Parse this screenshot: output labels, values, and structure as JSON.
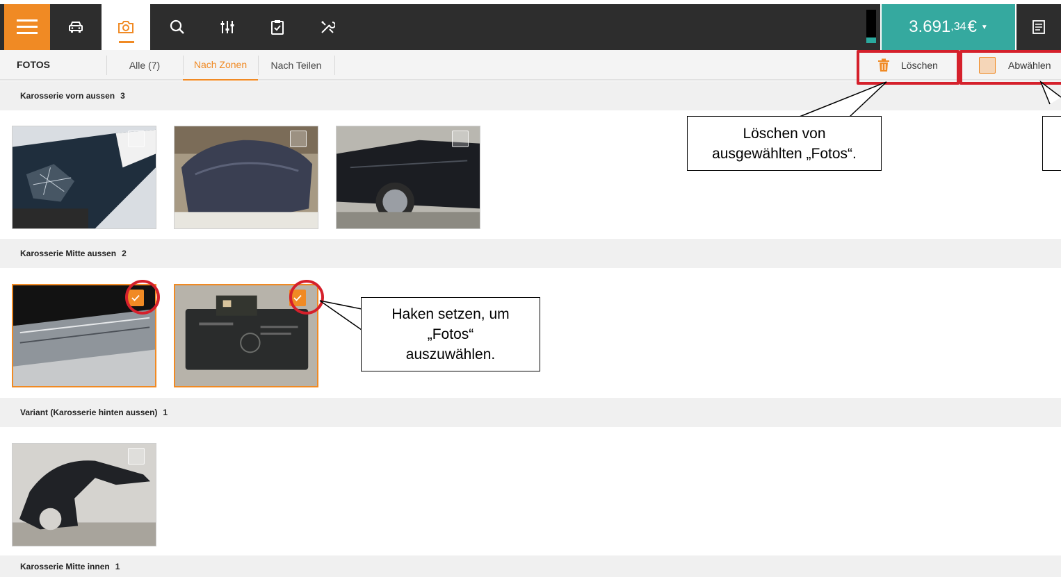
{
  "topbar": {
    "menu_icon": "hamburger-icon",
    "nav_icons": [
      "car-icon",
      "camera-icon",
      "search-icon",
      "sliders-icon",
      "checklist-icon",
      "tools-icon"
    ],
    "price_main": "3.691",
    "price_cents": ",34",
    "price_currency": "€",
    "receipt_icon": "receipt-icon",
    "brand_color": "#f08a24",
    "teal_color": "#35a99f"
  },
  "tabs": {
    "title": "FOTOS",
    "items": [
      {
        "label": "Alle (7)"
      },
      {
        "label": "Nach Zonen"
      },
      {
        "label": "Nach Teilen"
      }
    ],
    "active": "Nach Zonen"
  },
  "actions": {
    "delete_label": "Löschen",
    "deselect_label": "Abwählen"
  },
  "sections": [
    {
      "title": "Karosserie vorn aussen",
      "count": "3"
    },
    {
      "title": "Karosserie Mitte aussen",
      "count": "2"
    },
    {
      "title": "Variant (Karosserie hinten aussen)",
      "count": "1"
    },
    {
      "title": "Karosserie Mitte innen",
      "count": "1"
    }
  ],
  "callouts": {
    "delete": {
      "line1": "Löschen von",
      "line2": "ausgewählten „Fotos“."
    },
    "select": {
      "line1": "Haken setzen, um",
      "line2": "„Fotos“",
      "line3": "auszuwählen."
    }
  }
}
